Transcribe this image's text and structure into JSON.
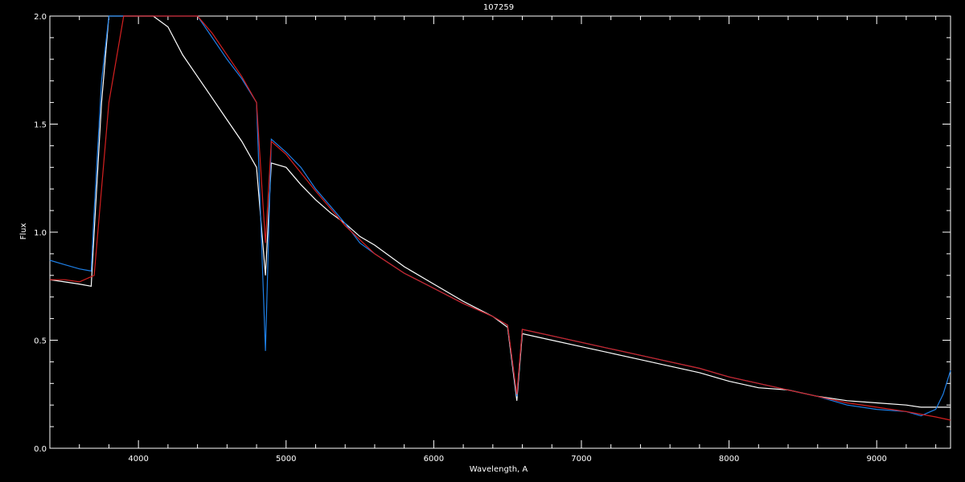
{
  "chart_data": {
    "type": "line",
    "title": "107259",
    "xlabel": "Wavelength, A",
    "ylabel": "Flux",
    "xlim": [
      3400,
      9500
    ],
    "ylim": [
      0.0,
      2.0
    ],
    "x_ticks": [
      4000,
      5000,
      6000,
      7000,
      8000,
      9000
    ],
    "x_tick_labels": [
      "4000",
      "5000",
      "6000",
      "7000",
      "8000",
      "9000"
    ],
    "y_ticks": [
      0.0,
      0.5,
      1.0,
      1.5,
      2.0
    ],
    "y_tick_labels": [
      "0.0",
      "0.5",
      "1.0",
      "1.5",
      "2.0"
    ],
    "grid": false,
    "series": [
      {
        "color": "#ffffff",
        "x": [
          3400,
          3500,
          3600,
          3680,
          3700,
          3750,
          3800,
          3900,
          4000,
          4100,
          4200,
          4300,
          4400,
          4500,
          4600,
          4700,
          4800,
          4860,
          4900,
          5000,
          5100,
          5200,
          5300,
          5400,
          5500,
          5600,
          5800,
          6000,
          6200,
          6400,
          6500,
          6563,
          6600,
          6800,
          7000,
          7200,
          7400,
          7600,
          7800,
          8000,
          8200,
          8400,
          8600,
          8800,
          9000,
          9200,
          9300,
          9400,
          9500
        ],
        "y": [
          0.78,
          0.77,
          0.76,
          0.75,
          1.0,
          1.6,
          2.0,
          2.0,
          2.0,
          2.0,
          1.95,
          1.82,
          1.72,
          1.62,
          1.52,
          1.42,
          1.3,
          0.8,
          1.32,
          1.3,
          1.22,
          1.15,
          1.09,
          1.04,
          0.98,
          0.94,
          0.84,
          0.76,
          0.68,
          0.61,
          0.56,
          0.22,
          0.53,
          0.5,
          0.47,
          0.44,
          0.41,
          0.38,
          0.35,
          0.31,
          0.28,
          0.27,
          0.24,
          0.22,
          0.21,
          0.2,
          0.19,
          0.19,
          0.19
        ]
      },
      {
        "color": "#1e7fe6",
        "x": [
          3400,
          3500,
          3600,
          3680,
          3700,
          3750,
          3800,
          3900,
          4000,
          4100,
          4200,
          4300,
          4400,
          4500,
          4600,
          4700,
          4800,
          4860,
          4900,
          5000,
          5100,
          5200,
          5300,
          5400,
          5500,
          5600,
          5800,
          6000,
          6200,
          6400,
          6500,
          6563,
          6600,
          6800,
          7000,
          7200,
          7400,
          7600,
          7800,
          8000,
          8200,
          8400,
          8600,
          8800,
          9000,
          9200,
          9300,
          9400,
          9450,
          9500
        ],
        "y": [
          0.87,
          0.85,
          0.83,
          0.82,
          1.1,
          1.7,
          2.0,
          2.0,
          2.0,
          2.0,
          2.0,
          2.0,
          2.0,
          1.9,
          1.8,
          1.71,
          1.6,
          0.45,
          1.43,
          1.37,
          1.3,
          1.2,
          1.12,
          1.04,
          0.95,
          0.9,
          0.81,
          0.74,
          0.67,
          0.61,
          0.57,
          0.24,
          0.55,
          0.52,
          0.49,
          0.46,
          0.43,
          0.4,
          0.37,
          0.33,
          0.3,
          0.27,
          0.24,
          0.2,
          0.18,
          0.17,
          0.15,
          0.18,
          0.25,
          0.36
        ]
      },
      {
        "color": "#d42020",
        "x": [
          3400,
          3500,
          3600,
          3700,
          3800,
          3900,
          4000,
          4100,
          4200,
          4300,
          4400,
          4500,
          4600,
          4700,
          4800,
          4860,
          4900,
          5000,
          5200,
          5400,
          5600,
          5800,
          6000,
          6200,
          6400,
          6500,
          6563,
          6600,
          6800,
          7000,
          7200,
          7400,
          7600,
          7800,
          8000,
          8200,
          8400,
          8600,
          8800,
          9000,
          9200,
          9400,
          9500
        ],
        "y": [
          0.78,
          0.78,
          0.77,
          0.8,
          1.6,
          2.0,
          2.0,
          2.0,
          2.0,
          2.0,
          2.0,
          1.92,
          1.82,
          1.72,
          1.6,
          0.95,
          1.42,
          1.36,
          1.19,
          1.03,
          0.9,
          0.81,
          0.74,
          0.67,
          0.61,
          0.57,
          0.25,
          0.55,
          0.52,
          0.49,
          0.46,
          0.43,
          0.4,
          0.37,
          0.33,
          0.3,
          0.27,
          0.24,
          0.21,
          0.19,
          0.17,
          0.145,
          0.13
        ]
      }
    ]
  }
}
